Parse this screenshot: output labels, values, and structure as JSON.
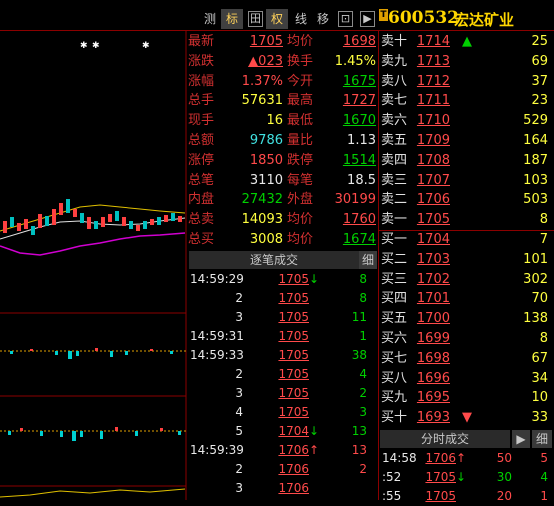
{
  "toolbar": {
    "buttons": [
      "测",
      "标",
      "田",
      "权",
      "线",
      "移",
      "⊡",
      "▶"
    ],
    "selected": [
      1,
      3
    ],
    "stock_badge": "T",
    "stock_code": "600532",
    "stock_name": "宏达矿业"
  },
  "colors": {
    "up": "#ff4a4a",
    "down": "#00d000",
    "label": "#d03030",
    "grid": "#8b0000",
    "highlight": "#ffd700"
  },
  "stats_left": [
    {
      "label": "最新",
      "value": "1705",
      "color": "red",
      "underline": true
    },
    {
      "label": "涨跌",
      "value": "▲023",
      "color": "red",
      "underline": true
    },
    {
      "label": "涨幅",
      "value": "1.37%",
      "color": "red"
    },
    {
      "label": "总手",
      "value": "57631",
      "color": "yellow"
    },
    {
      "label": "现手",
      "value": "16",
      "color": "yellow"
    },
    {
      "label": "总额",
      "value": "9786",
      "color": "cyan"
    },
    {
      "label": "涨停",
      "value": "1850",
      "color": "red"
    },
    {
      "label": "总笔",
      "value": "3110",
      "color": "white"
    },
    {
      "label": "内盘",
      "value": "27432",
      "color": "green"
    },
    {
      "label": "总卖",
      "value": "14093",
      "color": "yellow"
    },
    {
      "label": "总买",
      "value": "3008",
      "color": "yellow"
    }
  ],
  "stats_right": [
    {
      "label": "均价",
      "value": "1698",
      "color": "red",
      "underline": true
    },
    {
      "label": "换手",
      "value": "1.45%",
      "color": "yellow"
    },
    {
      "label": "今开",
      "value": "1675",
      "color": "green",
      "underline": true
    },
    {
      "label": "最高",
      "value": "1727",
      "color": "red",
      "underline": true
    },
    {
      "label": "最低",
      "value": "1670",
      "color": "green",
      "underline": true
    },
    {
      "label": "量比",
      "value": "1.13",
      "color": "white"
    },
    {
      "label": "跌停",
      "value": "1514",
      "color": "green",
      "underline": true
    },
    {
      "label": "每笔",
      "value": "18.5",
      "color": "white"
    },
    {
      "label": "外盘",
      "value": "30199",
      "color": "red"
    },
    {
      "label": "均价",
      "value": "1760",
      "color": "red",
      "underline": true
    },
    {
      "label": "均价",
      "value": "1674",
      "color": "green",
      "underline": true
    }
  ],
  "order_book": [
    {
      "label": "卖十",
      "price": "1714",
      "qty": "25",
      "arrow": "▲"
    },
    {
      "label": "卖九",
      "price": "1713",
      "qty": "69",
      "arrow": ""
    },
    {
      "label": "卖八",
      "price": "1712",
      "qty": "37",
      "arrow": ""
    },
    {
      "label": "卖七",
      "price": "1711",
      "qty": "23",
      "arrow": ""
    },
    {
      "label": "卖六",
      "price": "1710",
      "qty": "529",
      "arrow": ""
    },
    {
      "label": "卖五",
      "price": "1709",
      "qty": "164",
      "arrow": ""
    },
    {
      "label": "卖四",
      "price": "1708",
      "qty": "187",
      "arrow": ""
    },
    {
      "label": "卖三",
      "price": "1707",
      "qty": "103",
      "arrow": ""
    },
    {
      "label": "卖二",
      "price": "1706",
      "qty": "503",
      "arrow": ""
    },
    {
      "label": "卖一",
      "price": "1705",
      "qty": "8",
      "arrow": ""
    },
    {
      "label": "买一",
      "price": "1704",
      "qty": "7",
      "arrow": ""
    },
    {
      "label": "买二",
      "price": "1703",
      "qty": "101",
      "arrow": ""
    },
    {
      "label": "买三",
      "price": "1702",
      "qty": "302",
      "arrow": ""
    },
    {
      "label": "买四",
      "price": "1701",
      "qty": "70",
      "arrow": ""
    },
    {
      "label": "买五",
      "price": "1700",
      "qty": "138",
      "arrow": ""
    },
    {
      "label": "买六",
      "price": "1699",
      "qty": "8",
      "arrow": ""
    },
    {
      "label": "买七",
      "price": "1698",
      "qty": "67",
      "arrow": ""
    },
    {
      "label": "买八",
      "price": "1696",
      "qty": "34",
      "arrow": ""
    },
    {
      "label": "买九",
      "price": "1695",
      "qty": "10",
      "arrow": ""
    },
    {
      "label": "买十",
      "price": "1693",
      "qty": "33",
      "arrow": "▼"
    }
  ],
  "tick_panel": {
    "title": "逐笔成交",
    "detail_button": "细",
    "rows": [
      {
        "time": "14:59:29",
        "price": "1705",
        "arrow": "↓",
        "qty": "8",
        "dir": "down"
      },
      {
        "time": "2",
        "price": "1705",
        "arrow": "",
        "qty": "8",
        "dir": "down"
      },
      {
        "time": "3",
        "price": "1705",
        "arrow": "",
        "qty": "11",
        "dir": "down"
      },
      {
        "time": "14:59:31",
        "price": "1705",
        "arrow": "",
        "qty": "1",
        "dir": "down"
      },
      {
        "time": "14:59:33",
        "price": "1705",
        "arrow": "",
        "qty": "38",
        "dir": "down"
      },
      {
        "time": "2",
        "price": "1705",
        "arrow": "",
        "qty": "4",
        "dir": "down"
      },
      {
        "time": "3",
        "price": "1705",
        "arrow": "",
        "qty": "2",
        "dir": "down"
      },
      {
        "time": "4",
        "price": "1705",
        "arrow": "",
        "qty": "3",
        "dir": "down"
      },
      {
        "time": "5",
        "price": "1704",
        "arrow": "↓",
        "qty": "13",
        "dir": "down"
      },
      {
        "time": "14:59:39",
        "price": "1706",
        "arrow": "↑",
        "qty": "13",
        "dir": "up"
      },
      {
        "time": "2",
        "price": "1706",
        "arrow": "",
        "qty": "2",
        "dir": "up"
      },
      {
        "time": "3",
        "price": "1706",
        "arrow": "",
        "qty": "",
        "dir": "up"
      }
    ]
  },
  "minute_panel": {
    "title": "分时成交",
    "nav_button": "▶",
    "detail_button": "细",
    "rows": [
      {
        "time": "14:58",
        "price": "1706",
        "arrow": "↑",
        "qty": "50",
        "extra": "5",
        "dir": "up"
      },
      {
        "time": ":52",
        "price": "1705",
        "arrow": "↓",
        "qty": "30",
        "extra": "4",
        "dir": "down"
      },
      {
        "time": ":55",
        "price": "1705",
        "arrow": "",
        "qty": "20",
        "extra": "1",
        "dir": "up"
      }
    ]
  },
  "chart_markers": [
    "✱",
    "✱",
    "✱"
  ]
}
